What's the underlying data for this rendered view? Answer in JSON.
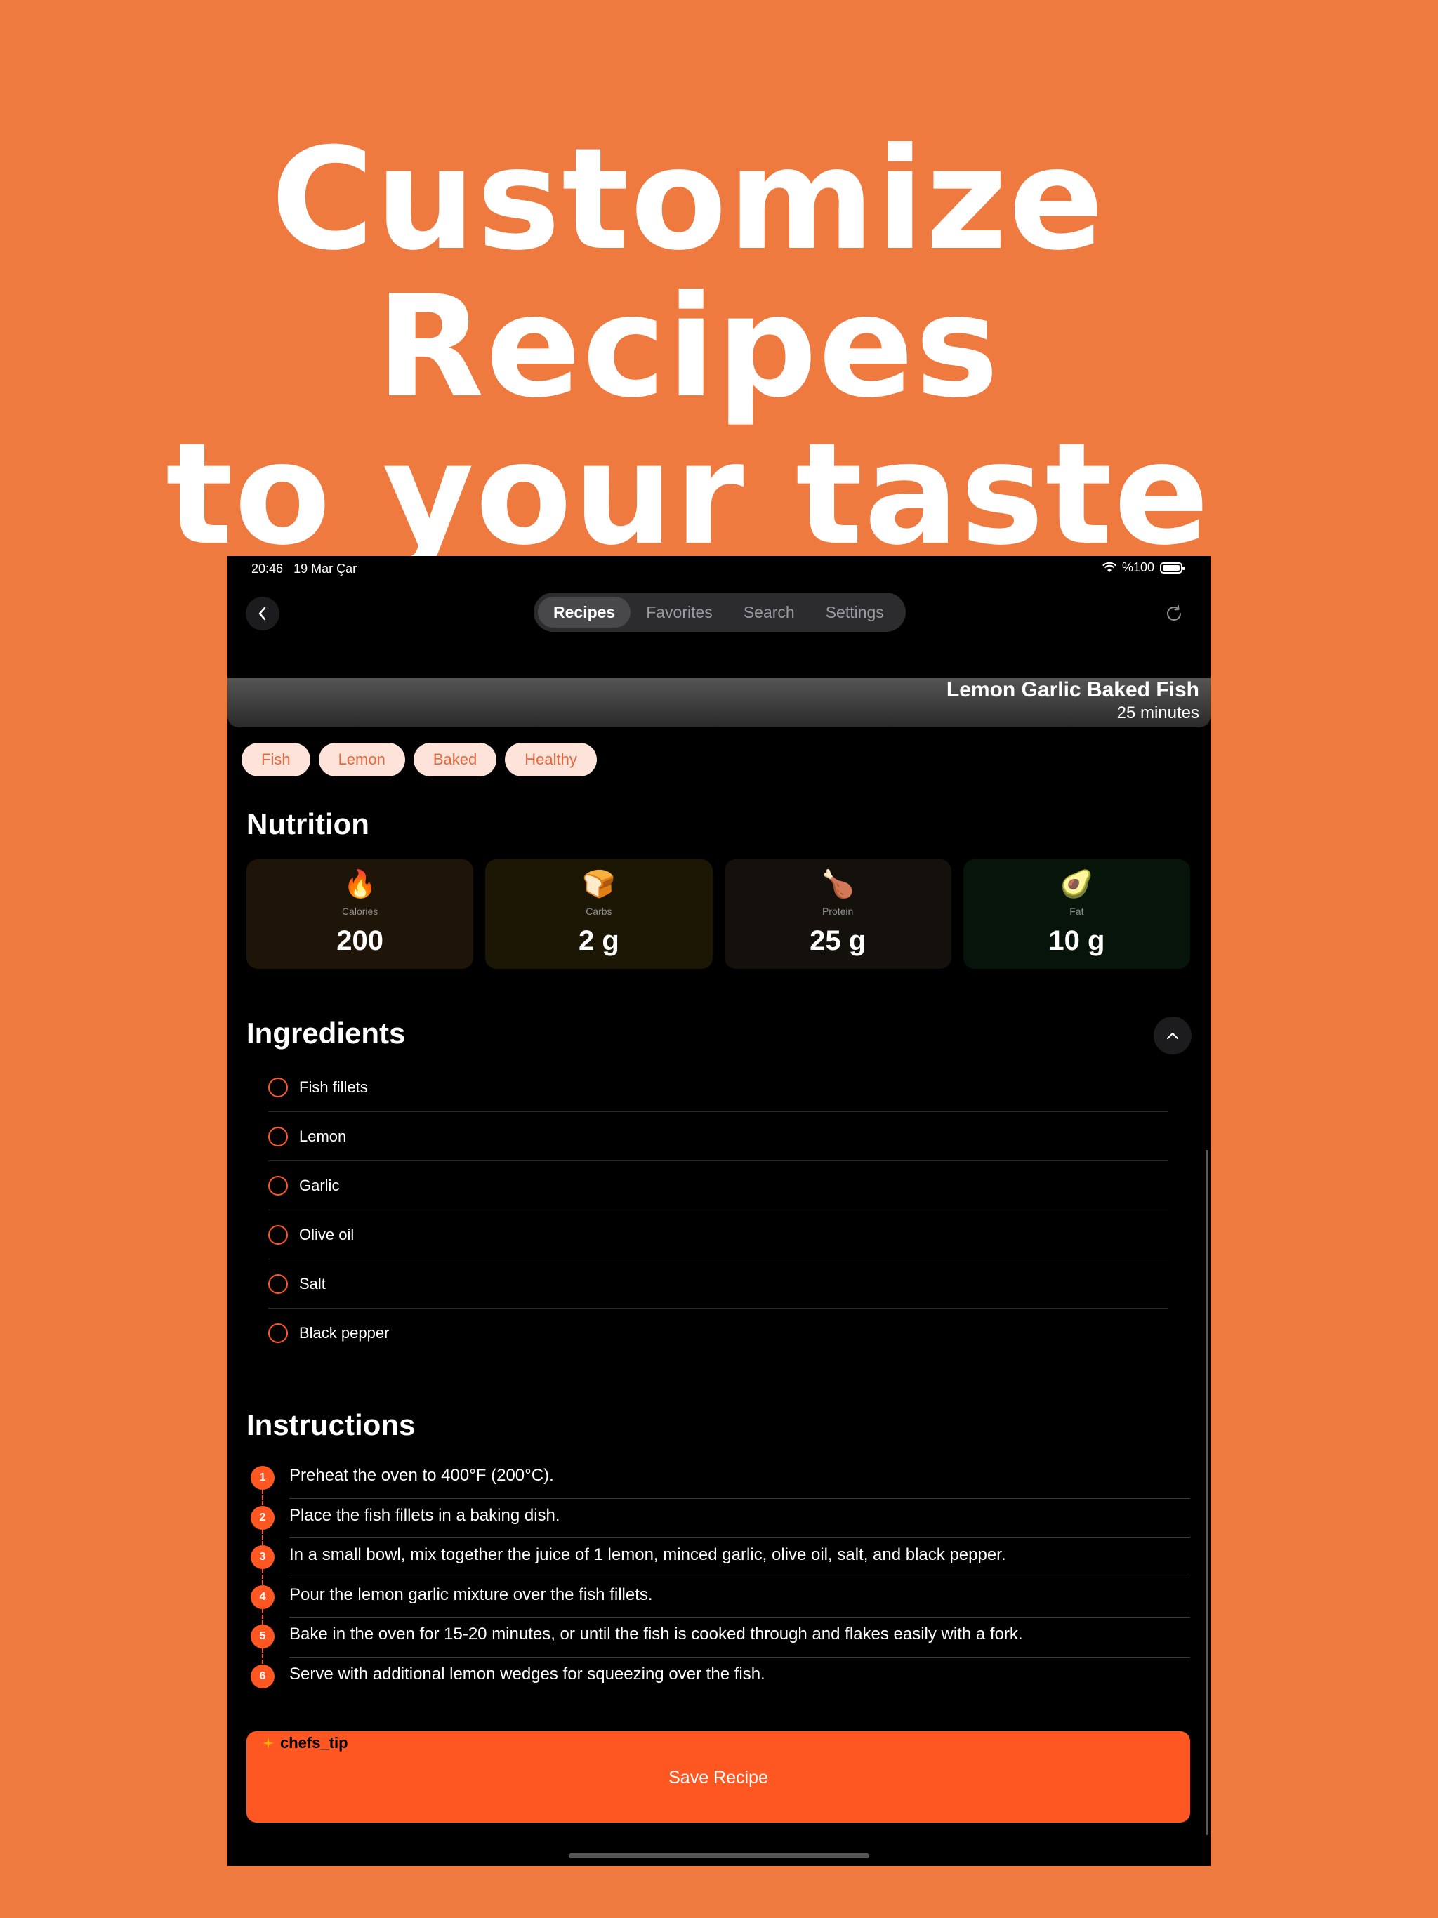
{
  "headline": {
    "line1": "Customize Recipes",
    "line2": "to your taste"
  },
  "status": {
    "time": "20:46",
    "date": "19 Mar Çar",
    "battery": "%100"
  },
  "nav": {
    "tabs": [
      {
        "label": "Recipes",
        "active": true
      },
      {
        "label": "Favorites",
        "active": false
      },
      {
        "label": "Search",
        "active": false
      },
      {
        "label": "Settings",
        "active": false
      }
    ]
  },
  "recipe": {
    "title": "Lemon Garlic Baked Fish",
    "duration": "25 minutes"
  },
  "tags": [
    "Fish",
    "Lemon",
    "Baked",
    "Healthy"
  ],
  "nutrition": {
    "title": "Nutrition",
    "items": [
      {
        "emoji": "🔥",
        "label": "Calories",
        "value": "200",
        "bg": "#1E1508"
      },
      {
        "emoji": "🍞",
        "label": "Carbs",
        "value": "2 g",
        "bg": "#1C1705"
      },
      {
        "emoji": "🍗",
        "label": "Protein",
        "value": "25 g",
        "bg": "#14110D"
      },
      {
        "emoji": "🥑",
        "label": "Fat",
        "value": "10 g",
        "bg": "#07140A"
      }
    ]
  },
  "ingredients": {
    "title": "Ingredients",
    "items": [
      "Fish fillets",
      "Lemon",
      "Garlic",
      "Olive oil",
      "Salt",
      "Black pepper"
    ]
  },
  "instructions": {
    "title": "Instructions",
    "steps": [
      {
        "num": "1",
        "text": "Preheat the oven to 400°F (200°C)."
      },
      {
        "num": "2",
        "text": "Place the fish fillets in a baking dish."
      },
      {
        "num": "3",
        "text": "In a small bowl, mix together the juice of 1 lemon, minced garlic, olive oil, salt, and black pepper."
      },
      {
        "num": "4",
        "text": "Pour the lemon garlic mixture over the fish fillets."
      },
      {
        "num": "5",
        "text": "Bake in the oven for 15-20 minutes, or until the fish is cooked through and flakes easily with a fork."
      },
      {
        "num": "6",
        "text": "Serve with additional lemon wedges for squeezing over the fish."
      }
    ]
  },
  "footer": {
    "tip_label": "chefs_tip",
    "save_label": "Save Recipe"
  },
  "colors": {
    "background": "#EF7A40",
    "accent": "#FF5722",
    "tag_bg": "#FDE3DA",
    "tag_text": "#E4673C"
  }
}
